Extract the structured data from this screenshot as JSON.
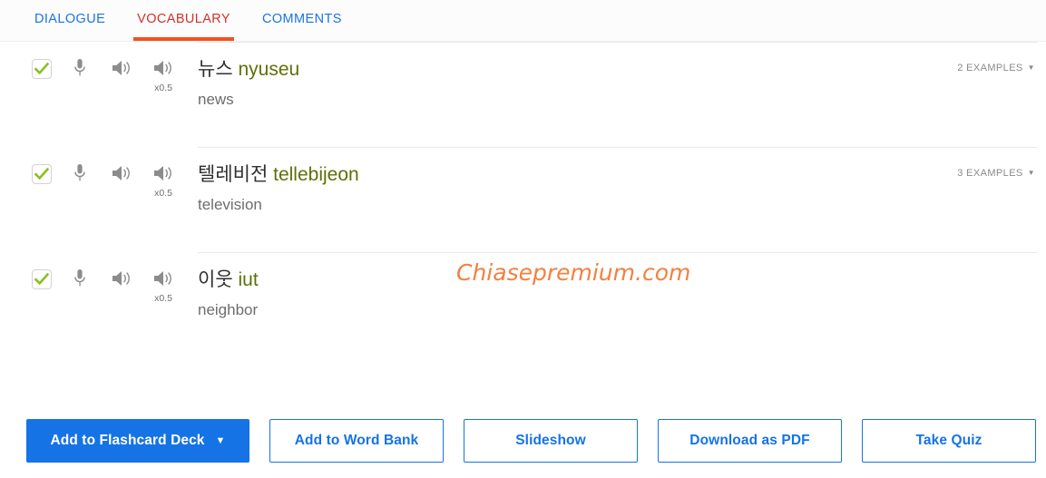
{
  "tabs": [
    {
      "label": "DIALOGUE",
      "active": false
    },
    {
      "label": "VOCABULARY",
      "active": true
    },
    {
      "label": "COMMENTS",
      "active": false
    }
  ],
  "colors": {
    "tab_inactive": "#1a73e8",
    "tab_active": "#d2312a",
    "tab_underline": "#f4511e",
    "romanization": "#5d7008",
    "check": "#8ac020",
    "button_blue": "#1573e6",
    "watermark": "#f48040"
  },
  "controls": {
    "checkbox_icon": "checkmark-icon",
    "mic_icon": "microphone-icon",
    "speaker_icon": "speaker-icon",
    "speaker_slow_icon": "speaker-slow-icon",
    "slow_speed_label": "x0.5"
  },
  "vocabulary": [
    {
      "checked": true,
      "hangul": "뉴스",
      "romanization": "nyuseu",
      "meaning": "news",
      "examples_label": "2 EXAMPLES",
      "speed_label": "x0.5"
    },
    {
      "checked": true,
      "hangul": "텔레비전",
      "romanization": "tellebijeon",
      "meaning": "television",
      "examples_label": "3 EXAMPLES",
      "speed_label": "x0.5"
    },
    {
      "checked": true,
      "hangul": "이웃",
      "romanization": "iut",
      "meaning": "neighbor",
      "examples_label": "",
      "speed_label": "x0.5"
    }
  ],
  "watermark": {
    "text": "Chiasepremium.com"
  },
  "actions": [
    {
      "label": "Add to Flashcard Deck",
      "style": "primary",
      "has_caret": true
    },
    {
      "label": "Add to Word Bank",
      "style": "outline",
      "has_caret": false
    },
    {
      "label": "Slideshow",
      "style": "outline",
      "has_caret": false
    },
    {
      "label": "Download as PDF",
      "style": "outline",
      "has_caret": false
    },
    {
      "label": "Take Quiz",
      "style": "outline",
      "has_caret": false
    }
  ]
}
